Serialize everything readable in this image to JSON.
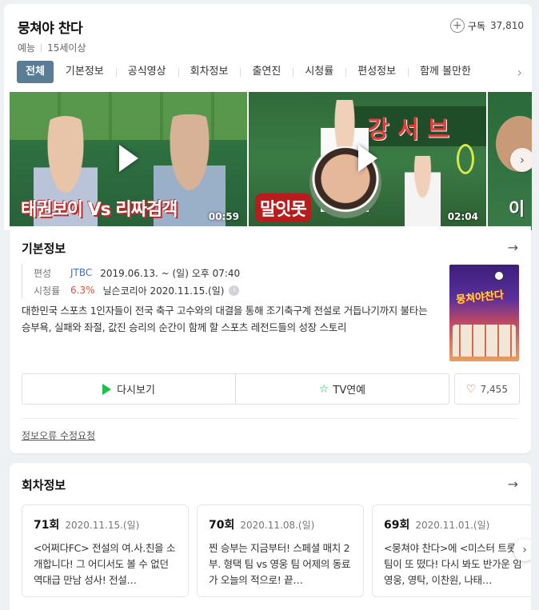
{
  "program": {
    "title": "뭉쳐야 찬다",
    "genre": "예능",
    "age_rating": "15세이상",
    "subscribe_label": "구독",
    "subscriber_count": "37,810"
  },
  "tabs": [
    {
      "label": "전체",
      "active": true
    },
    {
      "label": "기본정보",
      "active": false
    },
    {
      "label": "공식영상",
      "active": false
    },
    {
      "label": "회차정보",
      "active": false
    },
    {
      "label": "출연진",
      "active": false
    },
    {
      "label": "시청률",
      "active": false
    },
    {
      "label": "편성정보",
      "active": false
    },
    {
      "label": "함께 볼만한",
      "active": false
    }
  ],
  "videos": [
    {
      "caption": "태권보이 Vs 리짜검객",
      "duration": "00:59"
    },
    {
      "caption": "말잇못",
      "overlay_title": "강서브",
      "duration": "02:04"
    },
    {
      "caption": "이"
    }
  ],
  "basic_info": {
    "section_title": "기본정보",
    "schedule_label": "편성",
    "channel": "JTBC",
    "schedule": "2019.06.13. ~  (일) 오후 07:40",
    "rating_label": "시청률",
    "rating_value": "6.3%",
    "rating_source": "닐슨코리아 2020.11.15.(일)",
    "description": "대한민국 스포츠 1인자들이 전국 축구 고수와의 대결을 통해 조기축구계 전설로 거듭나기까지 불타는 승부욕, 실패와 좌절, 값진 승리의 순간이 함께 할 스포츠 레전드들의 성장 스토리",
    "poster_title": "뭉쳐야찬다",
    "replay_label": "다시보기",
    "tv_label": "TV연예",
    "like_count": "7,455",
    "report_label": "정보오류 수정요청"
  },
  "episodes": {
    "section_title": "회차정보",
    "items": [
      {
        "number": "71회",
        "date": "2020.11.15.(일)",
        "desc": "<어쩌다FC> 전설의 여.사.친을 소개합니다! 그 어디서도 볼 수 없던 역대급 만남 성사! 전설…"
      },
      {
        "number": "70회",
        "date": "2020.11.08.(일)",
        "desc": "찐 승부는 지금부터! 스페셜 매치 2부. 형택 팀 vs 영웅 팀 어제의 동료가 오늘의 적으로! 끝…"
      },
      {
        "number": "69회",
        "date": "2020.11.01.(일)",
        "desc": "<뭉쳐야 찬다>에 <미스터 트롯> 팀이 또 떴다! 다시 봐도 반가운 임영웅, 영탁, 이찬원, 나태…"
      }
    ]
  },
  "colors": {
    "active_tab": "#5a7d96",
    "channel": "#4a6fb4",
    "rating": "#e8503a",
    "accent_green": "#1fc14a"
  }
}
